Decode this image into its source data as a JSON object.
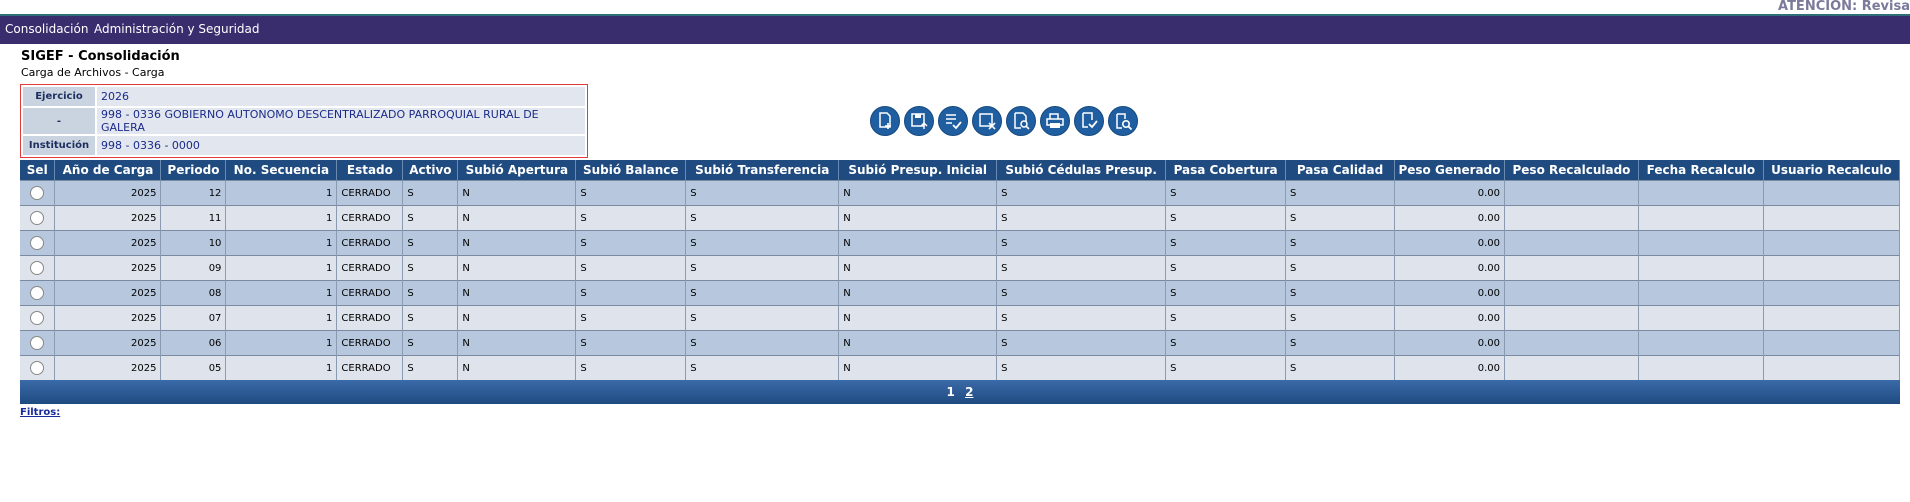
{
  "header": {
    "notice": "ATENCIÓN: Revisa"
  },
  "menu": {
    "items": [
      "Consolidación",
      "Administración y Seguridad"
    ]
  },
  "page": {
    "title": "SIGEF - Consolidación",
    "subtitle": "Carga de Archivos - Carga"
  },
  "info": {
    "ejercicio_label": "Ejercicio",
    "ejercicio_value": "2026",
    "unidad_label": "-",
    "unidad_value": "998 - 0336 GOBIERNO AUTONOMO DESCENTRALIZADO PARROQUIAL RURAL DE GALERA",
    "institucion_label": "Institución",
    "institucion_value": "998 - 0336 - 0000"
  },
  "toolbar": {
    "icons": [
      "new-file-icon",
      "save-upload-icon",
      "check-list-icon",
      "delete-record-icon",
      "search-document-icon",
      "print-icon",
      "approve-icon",
      "zoom-search-icon"
    ]
  },
  "table": {
    "columns": [
      "Sel",
      "Año de Carga",
      "Periodo",
      "No. Secuencia",
      "Estado",
      "Activo",
      "Subió Apertura",
      "Subió Balance",
      "Subió Transferencia",
      "Subió Presup. Inicial",
      "Subió Cédulas Presup.",
      "Pasa Cobertura",
      "Pasa Calidad",
      "Peso Generado",
      "Peso Recalculado",
      "Fecha Recalculo",
      "Usuario Recalculo"
    ],
    "rows": [
      [
        "2025",
        "12",
        "1",
        "CERRADO",
        "S",
        "N",
        "S",
        "S",
        "N",
        "S",
        "S",
        "S",
        "0.00",
        "",
        "",
        ""
      ],
      [
        "2025",
        "11",
        "1",
        "CERRADO",
        "S",
        "N",
        "S",
        "S",
        "N",
        "S",
        "S",
        "S",
        "0.00",
        "",
        "",
        ""
      ],
      [
        "2025",
        "10",
        "1",
        "CERRADO",
        "S",
        "N",
        "S",
        "S",
        "N",
        "S",
        "S",
        "S",
        "0.00",
        "",
        "",
        ""
      ],
      [
        "2025",
        "09",
        "1",
        "CERRADO",
        "S",
        "N",
        "S",
        "S",
        "N",
        "S",
        "S",
        "S",
        "0.00",
        "",
        "",
        ""
      ],
      [
        "2025",
        "08",
        "1",
        "CERRADO",
        "S",
        "N",
        "S",
        "S",
        "N",
        "S",
        "S",
        "S",
        "0.00",
        "",
        "",
        ""
      ],
      [
        "2025",
        "07",
        "1",
        "CERRADO",
        "S",
        "N",
        "S",
        "S",
        "N",
        "S",
        "S",
        "S",
        "0.00",
        "",
        "",
        ""
      ],
      [
        "2025",
        "06",
        "1",
        "CERRADO",
        "S",
        "N",
        "S",
        "S",
        "N",
        "S",
        "S",
        "S",
        "0.00",
        "",
        "",
        ""
      ],
      [
        "2025",
        "05",
        "1",
        "CERRADO",
        "S",
        "N",
        "S",
        "S",
        "N",
        "S",
        "S",
        "S",
        "0.00",
        "",
        "",
        ""
      ]
    ]
  },
  "pager": {
    "current": "1",
    "next": "2"
  },
  "filters": {
    "label": "Filtros:"
  }
}
